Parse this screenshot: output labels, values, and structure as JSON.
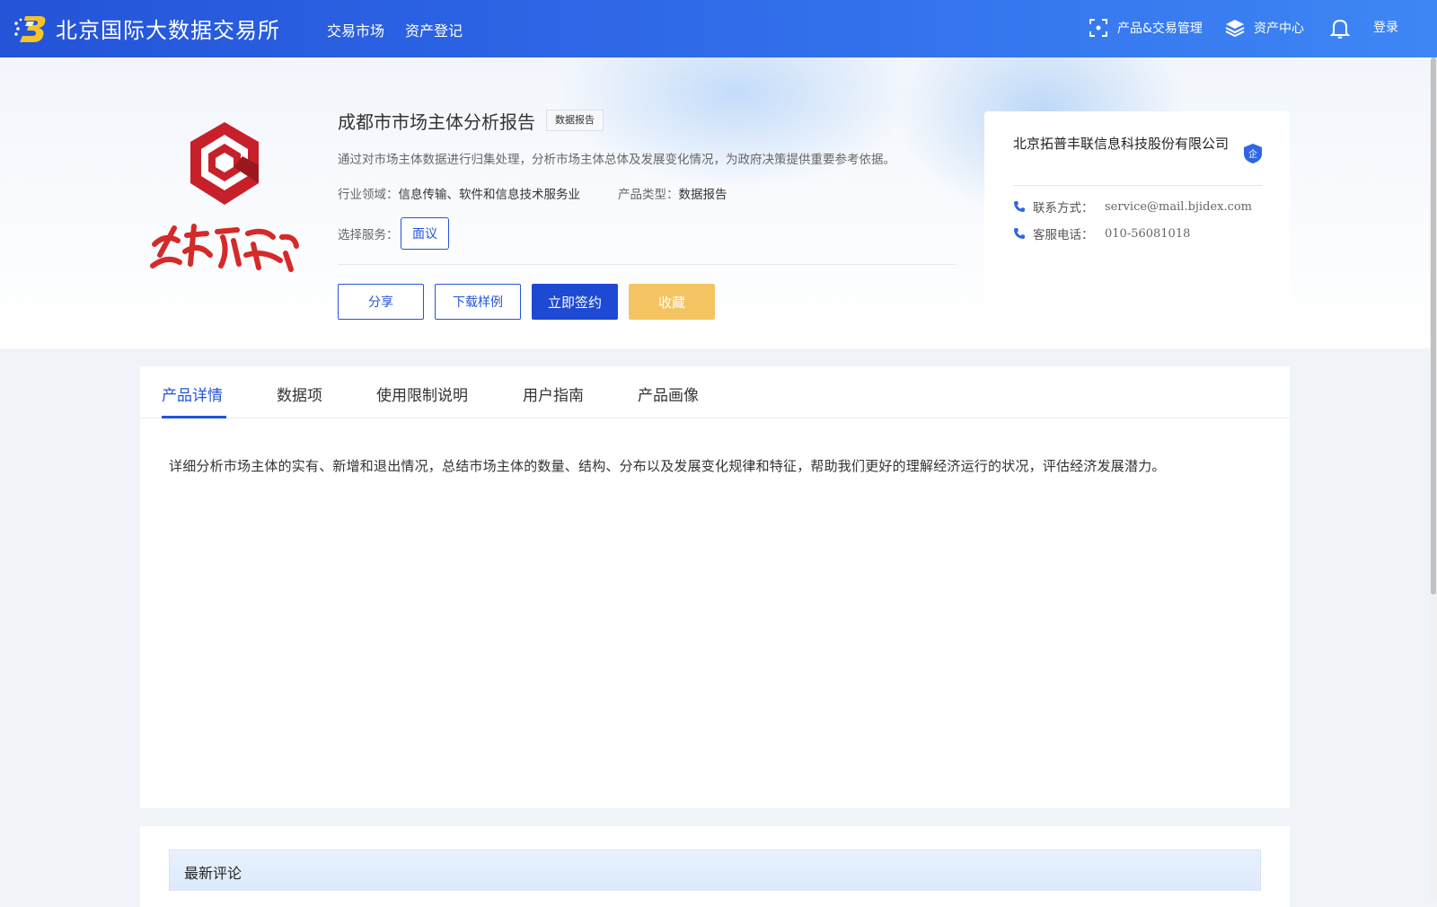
{
  "header": {
    "brand": "北京国际大数据交易所",
    "nav": [
      "交易市场",
      "资产登记"
    ],
    "right": {
      "product_trade": "产品&交易管理",
      "asset_center": "资产中心",
      "login": "登录"
    }
  },
  "product": {
    "title": "成都市市场主体分析报告",
    "tag": "数据报告",
    "description": "通过对市场主体数据进行归集处理，分析市场主体总体及发展变化情况，为政府决策提供重要参考依据。",
    "industry_label": "行业领域：",
    "industry_value": "信息传输、软件和信息技术服务业",
    "type_label": "产品类型：",
    "type_value": "数据报告",
    "service_label": "选择服务：",
    "service_option": "面议",
    "actions": {
      "share": "分享",
      "download": "下载样例",
      "sign": "立即签约",
      "favorite": "收藏"
    }
  },
  "company": {
    "name": "北京拓普丰联信息科技股份有限公司",
    "badge": "企",
    "contact_label": "联系方式：",
    "contact_value": "service@mail.bjidex.com",
    "phone_label": "客服电话：",
    "phone_value": "010-56081018"
  },
  "tabs": [
    "产品详情",
    "数据项",
    "使用限制说明",
    "用户指南",
    "产品画像"
  ],
  "active_tab": 0,
  "detail_text": "详细分析市场主体的实有、新增和退出情况，总结市场主体的数量、结构、分布以及发展变化规律和特征，帮助我们更好的理解经济运行的状况，评估经济发展潜力。",
  "comments": {
    "title": "最新评论"
  },
  "colors": {
    "primary": "#2454d8",
    "favorite": "#f5c462",
    "header_gradient_start": "#2454d8",
    "header_gradient_end": "#3e86f5",
    "logo_red": "#d42a2a"
  }
}
